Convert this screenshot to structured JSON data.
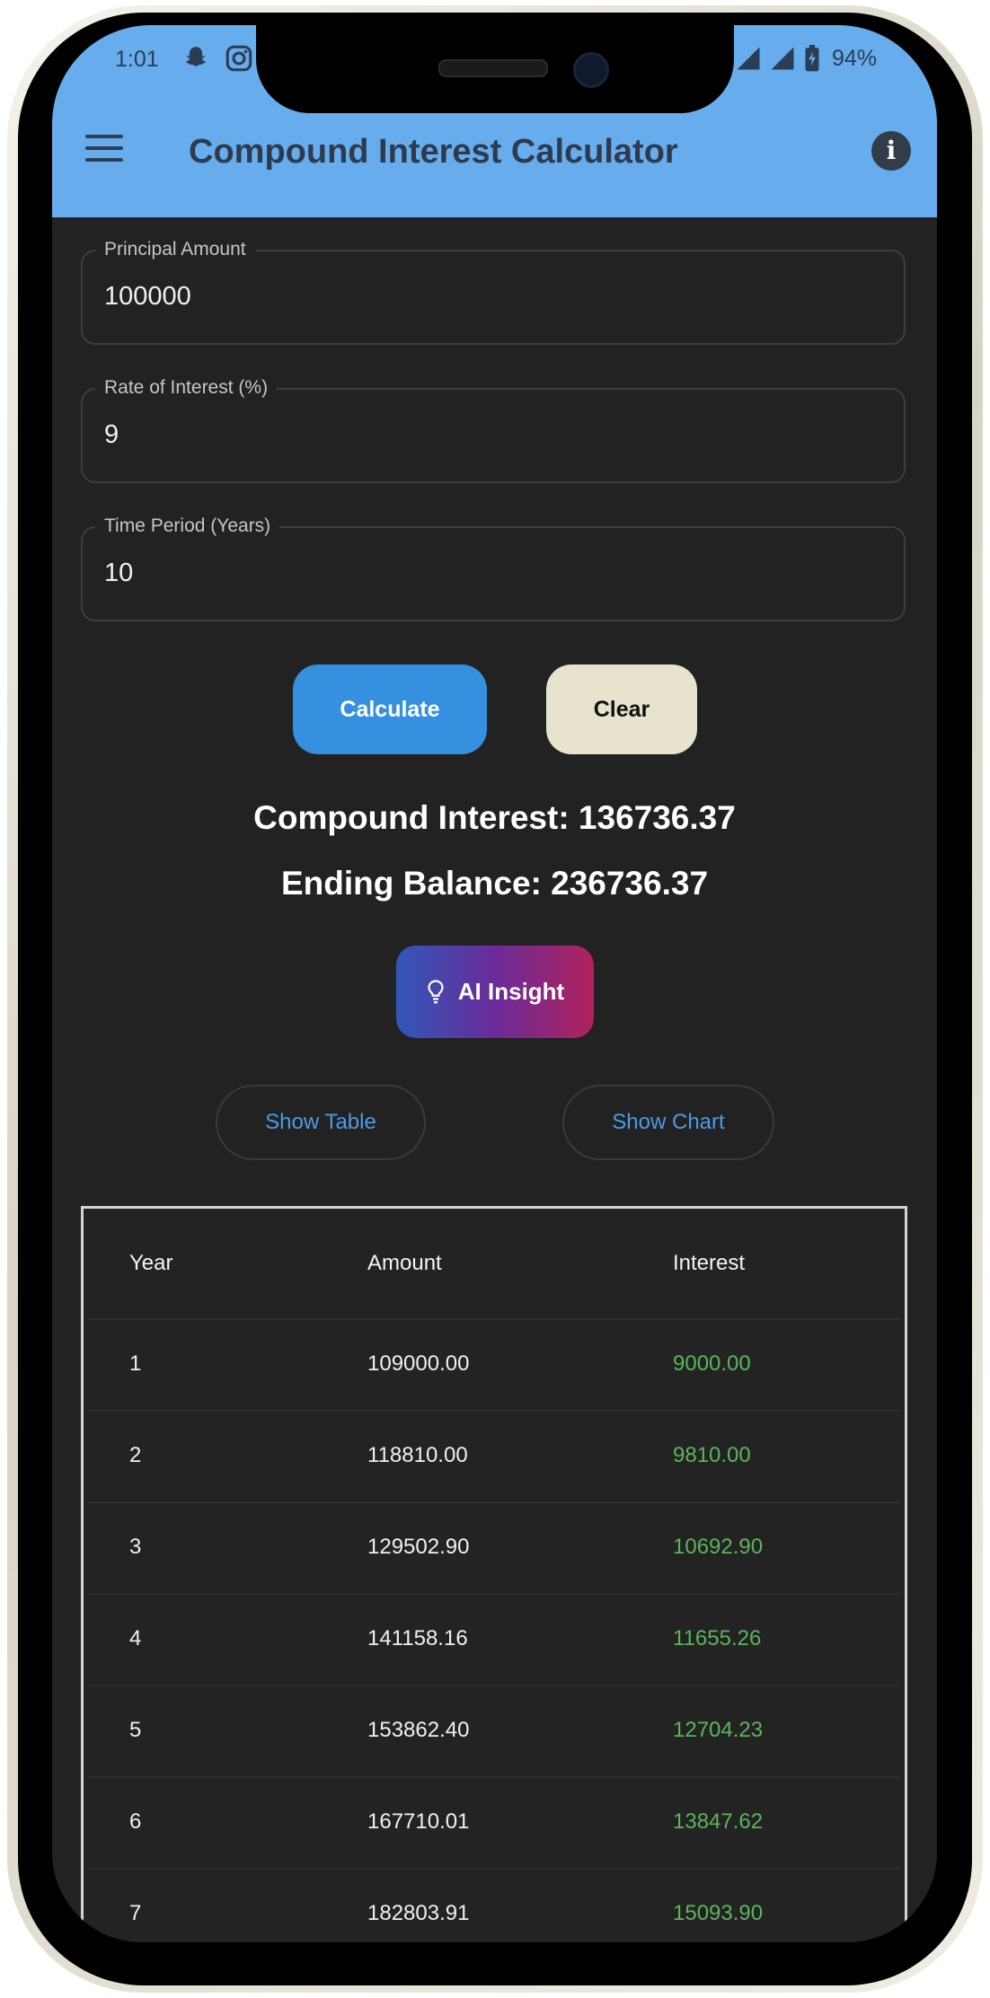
{
  "status_bar": {
    "time": "1:01",
    "left_icons": [
      "snapchat-icon",
      "instagram-icon"
    ],
    "right_icons": [
      "signal-icon",
      "signal-icon",
      "battery-charging-icon"
    ],
    "battery": "94%"
  },
  "app_bar": {
    "title": "Compound Interest Calculator",
    "background": "#67acec"
  },
  "form": {
    "principal": {
      "label": "Principal Amount",
      "value": "100000"
    },
    "rate": {
      "label": "Rate of Interest (%)",
      "value": "9"
    },
    "time": {
      "label": "Time Period (Years)",
      "value": "10"
    }
  },
  "buttons": {
    "calculate": "Calculate",
    "clear": "Clear",
    "ai_insight": "AI Insight",
    "show_table": "Show Table",
    "show_chart": "Show Chart"
  },
  "results": {
    "compound_interest": "Compound Interest: 136736.37",
    "ending_balance": "Ending Balance: 236736.37"
  },
  "table": {
    "headers": [
      "Year",
      "Amount",
      "Interest"
    ],
    "rows": [
      [
        "1",
        "109000.00",
        "9000.00"
      ],
      [
        "2",
        "118810.00",
        "9810.00"
      ],
      [
        "3",
        "129502.90",
        "10692.90"
      ],
      [
        "4",
        "141158.16",
        "11655.26"
      ],
      [
        "5",
        "153862.40",
        "12704.23"
      ],
      [
        "6",
        "167710.01",
        "13847.62"
      ],
      [
        "7",
        "182803.91",
        "15093.90"
      ]
    ]
  },
  "colors": {
    "accent": "#3590df",
    "interest_text": "#5bb55b",
    "background": "#222222"
  }
}
